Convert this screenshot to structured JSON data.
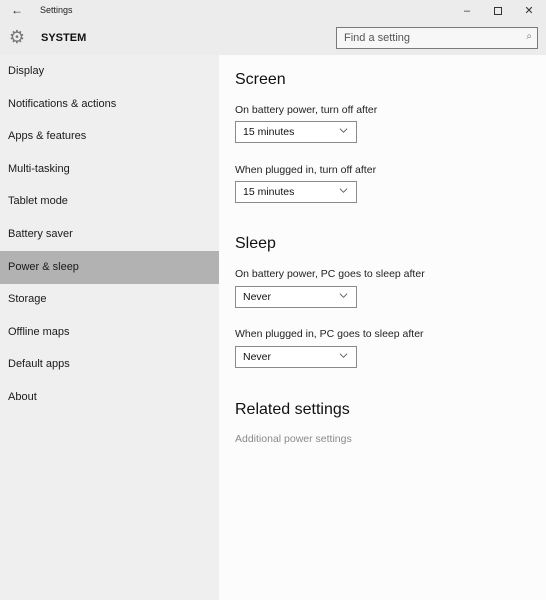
{
  "window": {
    "title": "Settings",
    "back_icon": "←",
    "minimize_icon": "–",
    "close_icon": "✕"
  },
  "header": {
    "section_icon": "⚙",
    "section_title": "SYSTEM",
    "search": {
      "placeholder": "Find a setting",
      "value": "",
      "icon": "⌕"
    }
  },
  "sidebar": {
    "items": [
      {
        "label": "Display",
        "active": false
      },
      {
        "label": "Notifications & actions",
        "active": false
      },
      {
        "label": "Apps & features",
        "active": false
      },
      {
        "label": "Multi-tasking",
        "active": false
      },
      {
        "label": "Tablet mode",
        "active": false
      },
      {
        "label": "Battery saver",
        "active": false
      },
      {
        "label": "Power & sleep",
        "active": true
      },
      {
        "label": "Storage",
        "active": false
      },
      {
        "label": "Offline maps",
        "active": false
      },
      {
        "label": "Default apps",
        "active": false
      },
      {
        "label": "About",
        "active": false
      }
    ]
  },
  "content": {
    "screen": {
      "heading": "Screen",
      "battery_label": "On battery power, turn off after",
      "battery_value": "15 minutes",
      "plugged_label": "When plugged in, turn off after",
      "plugged_value": "15 minutes"
    },
    "sleep": {
      "heading": "Sleep",
      "battery_label": "On battery power, PC goes to sleep after",
      "battery_value": "Never",
      "plugged_label": "When plugged in, PC goes to sleep after",
      "plugged_value": "Never"
    },
    "related": {
      "heading": "Related settings",
      "link": "Additional power settings"
    }
  }
}
